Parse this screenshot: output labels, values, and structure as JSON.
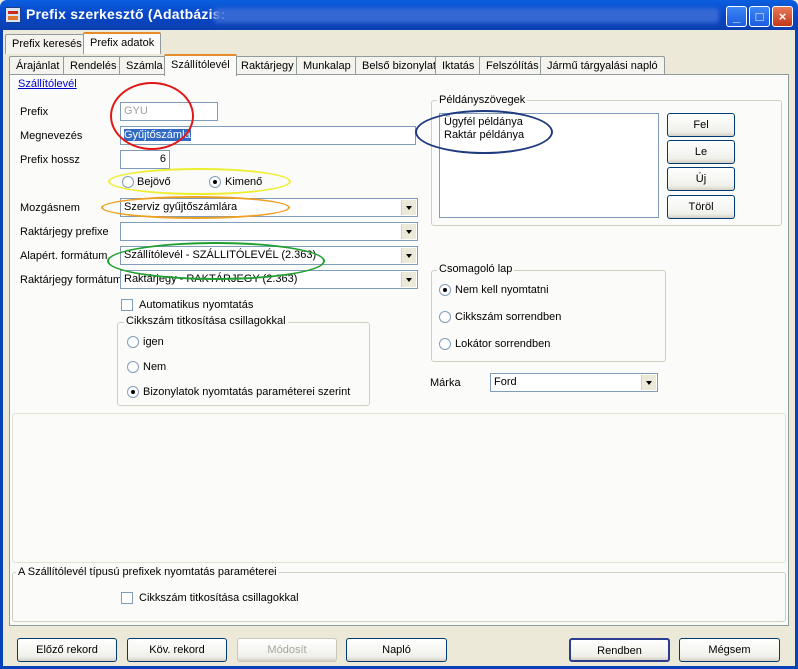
{
  "window": {
    "title": "Prefix szerkesztő   (Adatbázis:",
    "min_label": "_",
    "max_label": "□",
    "close_label": "×"
  },
  "top_tabs": [
    "Prefix keresés",
    "Prefix adatok"
  ],
  "doc_tabs": [
    "Árajánlat",
    "Rendelés",
    "Számla",
    "Szállítólevél",
    "Raktárjegy",
    "Munkalap",
    "Belső bizonylat",
    "Iktatás",
    "Felszólítás",
    "Jármű tárgyalási napló"
  ],
  "form": {
    "section_link": "Szállítólevél",
    "prefix_label": "Prefix",
    "prefix_value": "GYU",
    "megnevezes_label": "Megnevezés",
    "megnevezes_value": "Gyűjtőszámla",
    "prefix_hossz_label": "Prefix hossz",
    "prefix_hossz_value": "6",
    "bejovo_label": "Bejövő",
    "kimeno_label": "Kimenő",
    "mozgasnem_label": "Mozgásnem",
    "mozgasnem_value": "Szerviz gyűjtőszámlára",
    "raktarjegy_prefixe_label": "Raktárjegy prefixe",
    "raktarjegy_prefixe_value": "",
    "alapert_formatum_label": "Alapért. formátum",
    "alapert_formatum_value": "Szállítólevél - SZÁLLITÓLEVÉL (2.363)",
    "raktarjegy_formatum_label": "Raktárjegy formátum",
    "raktarjegy_formatum_value": "Raktárjegy - RAKTÁRJEGY (2.363)",
    "auto_print_label": "Automatikus nyomtatás",
    "cikkszam_group_title": "Cikkszám titkosítása csillagokkal",
    "opt_igen": "igen",
    "opt_nem": "Nem",
    "opt_biz": "Bizonylatok nyomtatás paraméterei szerint"
  },
  "peldany": {
    "title": "Példányszövegek",
    "items": [
      "Ügyfél példánya",
      "Raktár példánya"
    ],
    "btn_fel": "Fel",
    "btn_le": "Le",
    "btn_uj": "Új",
    "btn_torol": "Töröl"
  },
  "csomagolo": {
    "title": "Csomagoló lap",
    "opt1": "Nem kell nyomtatni",
    "opt2": "Cikkszám sorrendben",
    "opt3": "Lokátor sorrendben"
  },
  "marka": {
    "label": "Márka",
    "value": "Ford"
  },
  "print_params": {
    "title": "A Szállítólevél típusú prefixek nyomtatás paraméterei",
    "checkbox_label": "Cikkszám titkosítása csillagokkal"
  },
  "buttons": {
    "prev": "Előző rekord",
    "next": "Köv. rekord",
    "modify": "Módosít",
    "log": "Napló",
    "ok": "Rendben",
    "cancel": "Mégsem"
  },
  "colors": {
    "red": "#e01818",
    "yellow": "#eeee30",
    "orange": "#f0a020",
    "green": "#20a030",
    "navy": "#203a80"
  }
}
